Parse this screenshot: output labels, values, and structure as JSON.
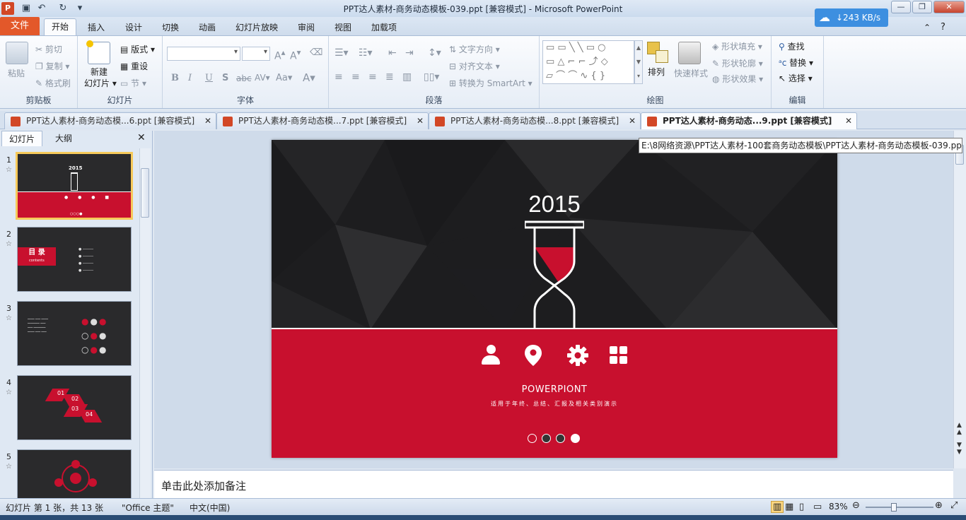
{
  "window": {
    "title": "PPT达人素材-商务动态模板-039.ppt [兼容模式] - Microsoft PowerPoint",
    "net_speed": "↓243 KB/s",
    "controls": [
      "—",
      "❐",
      "✕"
    ]
  },
  "ribbon": {
    "tabs": [
      "文件",
      "开始",
      "插入",
      "设计",
      "切换",
      "动画",
      "幻灯片放映",
      "审阅",
      "视图",
      "加载项"
    ],
    "groups": {
      "clipboard": {
        "label": "剪贴板",
        "paste": "粘贴",
        "cut": "剪切",
        "copy": "复制",
        "format_painter": "格式刷"
      },
      "slides": {
        "label": "幻灯片",
        "new_slide_line1": "新建",
        "new_slide_line2": "幻灯片",
        "layout": "版式",
        "reset": "重设",
        "section": "节"
      },
      "font": {
        "label": "字体"
      },
      "paragraph": {
        "label": "段落",
        "text_direction": "文字方向",
        "align_text": "对齐文本",
        "convert_smartart": "转换为 SmartArt"
      },
      "drawing": {
        "label": "绘图",
        "arrange": "排列",
        "quick_styles": "快速样式",
        "shape_fill": "形状填充",
        "shape_outline": "形状轮廓",
        "shape_effects": "形状效果"
      },
      "editing": {
        "label": "编辑",
        "find": "查找",
        "replace": "替换",
        "select": "选择"
      }
    }
  },
  "doc_tabs": [
    {
      "label": "PPT达人素材-商务动态模...6.ppt [兼容模式]",
      "active": false
    },
    {
      "label": "PPT达人素材-商务动态模...7.ppt [兼容模式]",
      "active": false
    },
    {
      "label": "PPT达人素材-商务动态模...8.ppt [兼容模式]",
      "active": false
    },
    {
      "label": "PPT达人素材-商务动态...9.ppt [兼容模式]",
      "active": true
    }
  ],
  "tooltip": "E:\\8网络资源\\PPT达人素材-100套商务动态模板\\PPT达人素材-商务动态模板-039.ppt",
  "left_pane": {
    "tabs": [
      "幻灯片",
      "大纲"
    ],
    "slide_numbers": [
      "1",
      "2",
      "3",
      "4",
      "5"
    ],
    "thumb2_title": "目 录",
    "thumb2_sub": "contents",
    "thumb4_nums": [
      "01",
      "02",
      "03",
      "04"
    ]
  },
  "slide": {
    "year": "2015",
    "title": "POWERPIONT",
    "subtitle": "适用于年终、总结、汇报及相关类别演示",
    "accent": "#c8102e",
    "dark_bg": "#1d1d1f",
    "icons": [
      "user-icon",
      "location-pin-icon",
      "gear-icon",
      "grid-icon"
    ],
    "dots": 4,
    "active_dot": 4
  },
  "notes": {
    "placeholder": "单击此处添加备注"
  },
  "status": {
    "slide_info": "幻灯片 第 1 张，共 13 张",
    "theme": "\"Office 主题\"",
    "language": "中文(中国)",
    "zoom": "83%"
  }
}
